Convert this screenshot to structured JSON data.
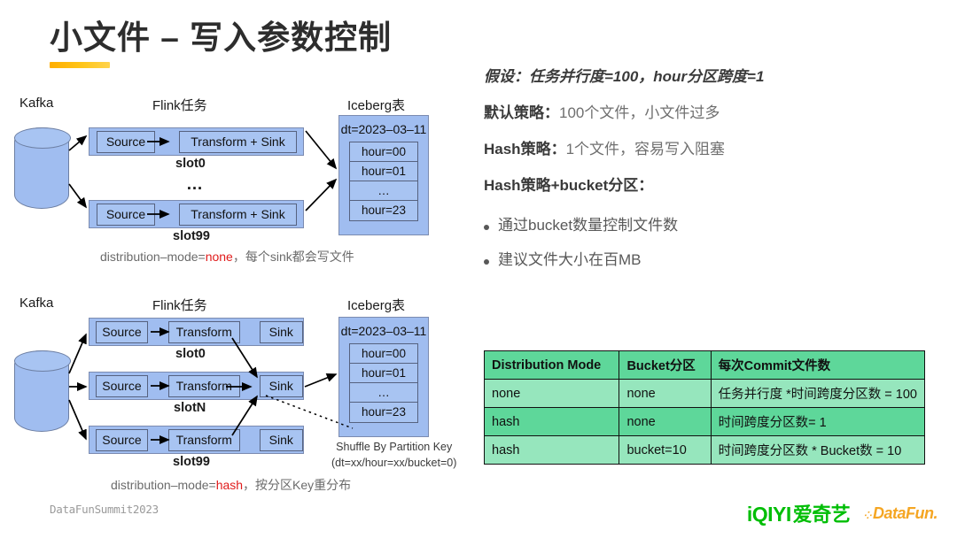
{
  "title": "小文件 – 写入参数控制",
  "diagram_top": {
    "headers": {
      "source": "Kafka",
      "middle": "Flink任务",
      "sink": "Iceberg表"
    },
    "slots": [
      {
        "nodes": [
          "Source",
          "Transform + Sink"
        ],
        "label": "slot0"
      },
      {
        "nodes": [
          "Source",
          "Transform + Sink"
        ],
        "label": "slot99"
      }
    ],
    "ellipsis": "…",
    "iceberg": {
      "dt": "dt=2023–03–11",
      "hours": [
        "hour=00",
        "hour=01",
        "…",
        "hour=23"
      ]
    },
    "caption_prefix": "distribution–mode=",
    "caption_value": "none",
    "caption_suffix": "，每个sink都会写文件"
  },
  "diagram_bottom": {
    "headers": {
      "source": "Kafka",
      "middle": "Flink任务",
      "sink": "Iceberg表"
    },
    "slots": [
      {
        "nodes": [
          "Source",
          "Transform",
          "Sink"
        ],
        "label": "slot0"
      },
      {
        "nodes": [
          "Source",
          "Transform",
          "Sink"
        ],
        "label": "slotN"
      },
      {
        "nodes": [
          "Source",
          "Transform",
          "Sink"
        ],
        "label": "slot99"
      }
    ],
    "iceberg": {
      "dt": "dt=2023–03–11",
      "hours": [
        "hour=00",
        "hour=01",
        "…",
        "hour=23"
      ]
    },
    "shuffle_note_line1": "Shuffle By Partition Key",
    "shuffle_note_line2": "(dt=xx/hour=xx/bucket=0)",
    "caption_prefix": "distribution–mode=",
    "caption_value": "hash",
    "caption_suffix": "，按分区Key重分布"
  },
  "right_text": {
    "assumption": "假设：任务并行度=100，hour分区跨度=1",
    "line2_bold": "默认策略：",
    "line2_rest": "100个文件，小文件过多",
    "line3_bold": "Hash策略：",
    "line3_rest": "1个文件，容易写入阻塞",
    "line4_bold": "Hash策略+bucket分区：",
    "bullets": [
      "通过bucket数量控制文件数",
      "建议文件大小在百MB"
    ]
  },
  "table": {
    "headers": [
      "Distribution Mode",
      "Bucket分区",
      "每次Commit文件数"
    ],
    "rows": [
      [
        "none",
        "none",
        "任务并行度 *时间跨度分区数 = 100"
      ],
      [
        "hash",
        "none",
        "时间跨度分区数= 1"
      ],
      [
        "hash",
        "bucket=10",
        "时间跨度分区数 * Bucket数 = 10"
      ]
    ]
  },
  "footer": {
    "label": "DataFunSummit2023",
    "iqiyi_en": "iQIYI",
    "iqiyi_cn": "爱奇艺",
    "datafun": "DataFun."
  },
  "colors": {
    "accent_underline": "#ffae00",
    "node_fill": "#a8c4f2",
    "slot_fill": "#a0bdf0",
    "table_header": "#5ed79a",
    "table_row_alt": "#96e6bd",
    "highlight_red": "#e01b1b",
    "iqiyi_green": "#00be06",
    "datafun_orange": "#f5a623"
  }
}
